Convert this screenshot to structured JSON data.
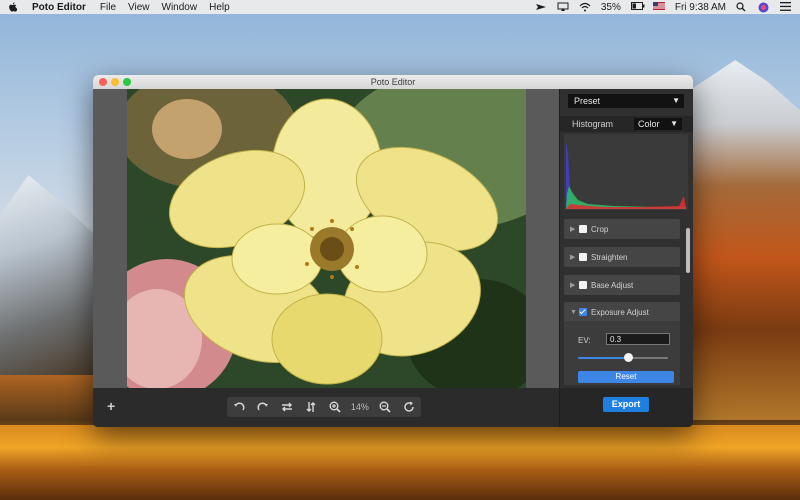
{
  "menubar": {
    "app_name": "Poto Editor",
    "items": [
      "File",
      "View",
      "Window",
      "Help"
    ],
    "battery": "35%",
    "clock": "Fri 9:38 AM"
  },
  "window": {
    "title": "Poto Editor"
  },
  "toolbar": {
    "zoom_label": "14%"
  },
  "panel": {
    "preset": "Preset",
    "histogram_label": "Histogram",
    "histogram_mode": "Color",
    "sections": [
      {
        "label": "Crop",
        "checked": false,
        "expanded": false
      },
      {
        "label": "Straighten",
        "checked": false,
        "expanded": false
      },
      {
        "label": "Base Adjust",
        "checked": false,
        "expanded": false
      },
      {
        "label": "Exposure Adjust",
        "checked": true,
        "expanded": true
      }
    ],
    "exposure": {
      "ev_label": "EV:",
      "ev_value": "0.3",
      "slider_fraction": 0.55,
      "reset_label": "Reset"
    },
    "export_label": "Export"
  },
  "colors": {
    "accent": "#3d86e6",
    "export": "#1f7fe0"
  }
}
